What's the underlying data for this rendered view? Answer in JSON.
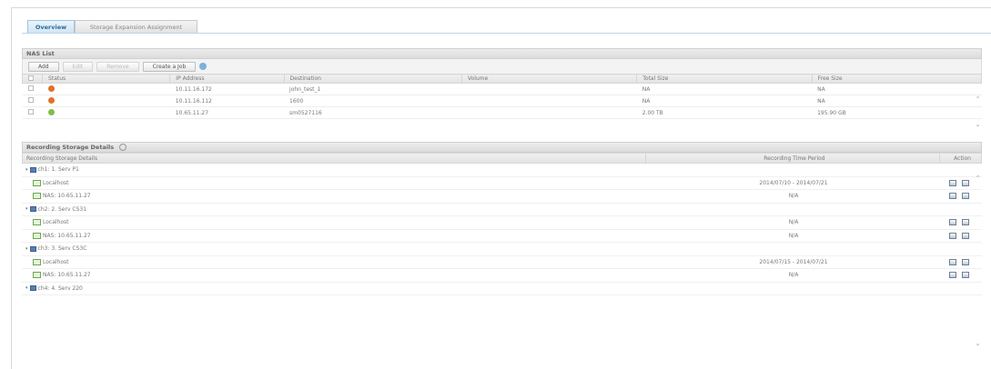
{
  "tabs": [
    {
      "label": "Overview",
      "active": true
    },
    {
      "label": "Storage Expansion Assignment",
      "active": false
    }
  ],
  "nas_list": {
    "title": "NAS List",
    "buttons": [
      "Add",
      "Edit",
      "Remove",
      "Create a Job"
    ],
    "columns": [
      "Status",
      "IP Address",
      "Destination",
      "Volume",
      "Total Size",
      "Free Size"
    ],
    "rows": [
      {
        "status": "error",
        "ip": "10.11.16.172",
        "destination": "john_test_1",
        "volume": "",
        "total": "NA",
        "free": "NA"
      },
      {
        "status": "error",
        "ip": "10.11.16.112",
        "destination": "1600",
        "volume": "",
        "total": "NA",
        "free": "NA"
      },
      {
        "status": "ok",
        "ip": "10.65.11.27",
        "destination": "sm0527116",
        "volume": "",
        "total": "2.00 TB",
        "free": "195.90 GB"
      }
    ]
  },
  "recording": {
    "title": "Recording Storage Details",
    "columns": [
      "Recording Storage Details",
      "Recording Time Period",
      "Action"
    ],
    "groups": [
      {
        "channel": "ch1: 1. Serv P1",
        "items": [
          {
            "name": "Localhost",
            "period": "2014/07/10 - 2014/07/21"
          },
          {
            "name": "NAS: 10.65.11.27",
            "period": "N/A"
          }
        ]
      },
      {
        "channel": "ch2: 2. Serv CS31",
        "items": [
          {
            "name": "Localhost",
            "period": "N/A"
          },
          {
            "name": "NAS: 10.65.11.27",
            "period": "N/A"
          }
        ]
      },
      {
        "channel": "ch3: 3. Serv CS3C",
        "items": [
          {
            "name": "Localhost",
            "period": "2014/07/15 - 2014/07/21"
          },
          {
            "name": "NAS: 10.65.11.27",
            "period": "N/A"
          }
        ]
      },
      {
        "channel": "ch4: 4. Serv 220",
        "items": []
      }
    ]
  },
  "colors": {
    "status_error": "#e0712b",
    "status_ok": "#7dbf4a",
    "tab_active": "#2d6b9c"
  }
}
